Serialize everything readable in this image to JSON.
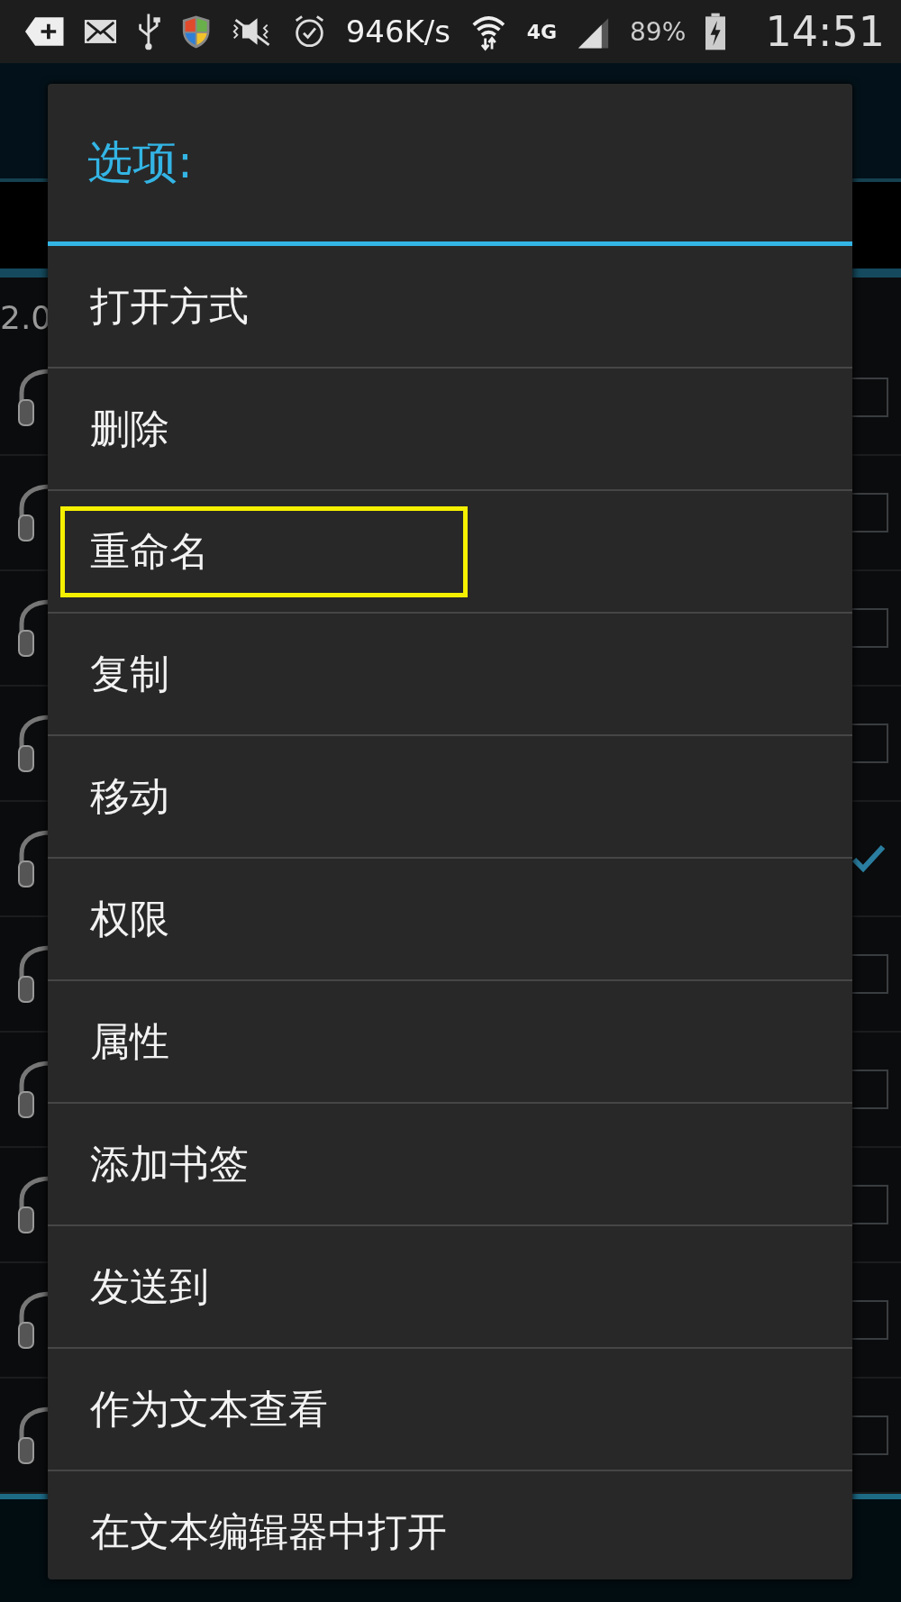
{
  "status_bar": {
    "speed": "946K/s",
    "network": "4G",
    "battery": "89%",
    "time": "14:51"
  },
  "background_list": {
    "partial_text": "2.0",
    "rows": [
      {
        "checked": false
      },
      {
        "checked": false
      },
      {
        "checked": false
      },
      {
        "checked": false
      },
      {
        "checked": true
      },
      {
        "checked": false
      },
      {
        "checked": false
      },
      {
        "checked": false
      },
      {
        "checked": false
      },
      {
        "checked": false
      }
    ]
  },
  "dialog": {
    "title": "选项:",
    "items": [
      {
        "label": "打开方式",
        "highlighted": false
      },
      {
        "label": "删除",
        "highlighted": false
      },
      {
        "label": "重命名",
        "highlighted": true
      },
      {
        "label": "复制",
        "highlighted": false
      },
      {
        "label": "移动",
        "highlighted": false
      },
      {
        "label": "权限",
        "highlighted": false
      },
      {
        "label": "属性",
        "highlighted": false
      },
      {
        "label": "添加书签",
        "highlighted": false
      },
      {
        "label": "发送到",
        "highlighted": false
      },
      {
        "label": "作为文本查看",
        "highlighted": false
      },
      {
        "label": "在文本编辑器中打开",
        "highlighted": false
      }
    ]
  }
}
